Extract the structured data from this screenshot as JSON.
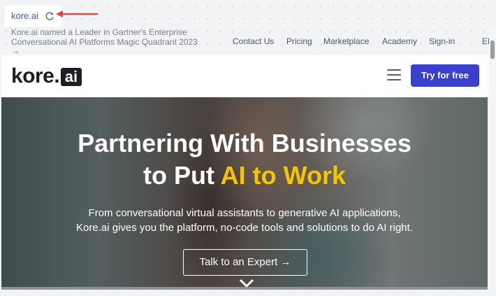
{
  "browser": {
    "url": "kore.ai",
    "reload_icon": "reload-icon",
    "annotation_color": "#e0443f"
  },
  "announcement": {
    "line1": "Kore.ai named a Leader in Gartner's Enterprise",
    "line2": "Conversational AI Platforms Magic Quadrant 2023",
    "arrow": "→"
  },
  "top_nav": {
    "items": [
      "Contact Us",
      "Pricing",
      "Marketplace",
      "Academy",
      "Sign-in"
    ],
    "language": "EN"
  },
  "header": {
    "logo_word": "kore",
    "logo_dot": ".",
    "logo_box": "ai",
    "menu_icon": "hamburger-menu-icon",
    "cta": "Try for free",
    "cta_color": "#3b3fce"
  },
  "hero": {
    "title_line1": "Partnering With Businesses",
    "title_line2_prefix": "to Put ",
    "title_line2_highlight": "AI to Work",
    "highlight_color": "#f7c500",
    "subtitle_line1": "From conversational virtual assistants to generative AI applications,",
    "subtitle_line2": "Kore.ai gives you the platform, no-code tools and solutions to do AI right.",
    "button_label": "Talk to an Expert",
    "button_arrow": "→",
    "scroll_icon": "chevron-down-icon"
  }
}
